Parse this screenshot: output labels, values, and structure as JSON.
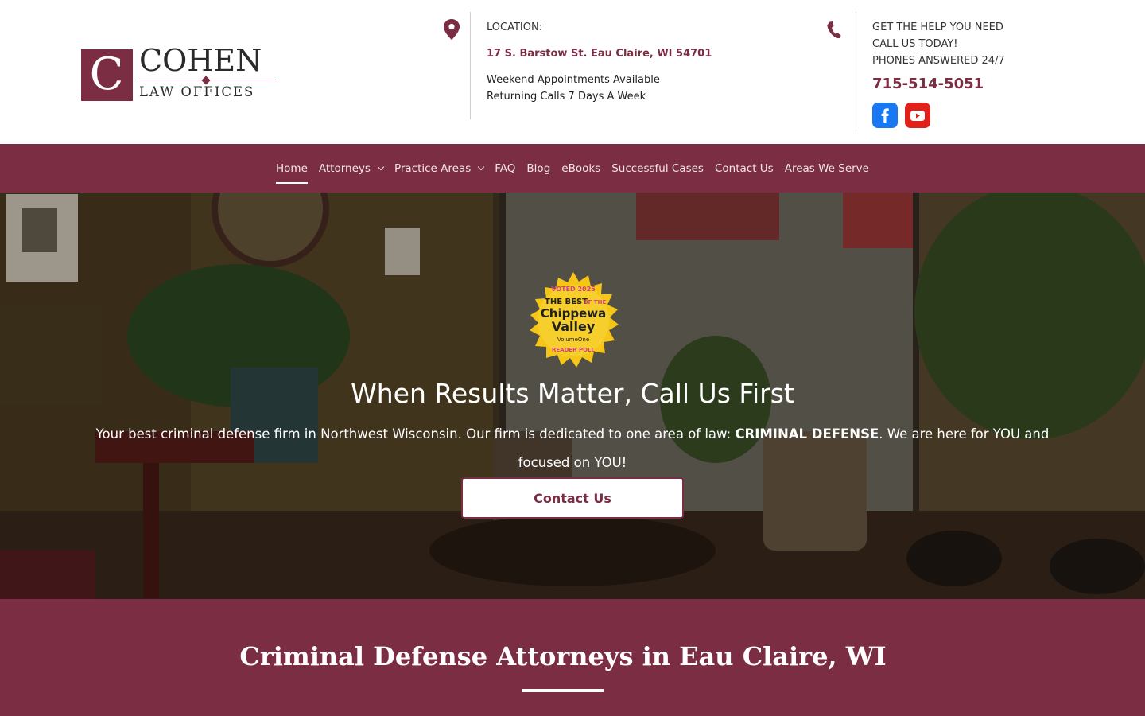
{
  "brand": {
    "logo_letter": "C",
    "logo_name": "COHEN",
    "logo_subtitle": "LAW OFFICES",
    "primary_color": "#7b2d43"
  },
  "contact": {
    "location_label": "LOCATION:",
    "address": "17 S. Barstow St. Eau Claire, WI 54701",
    "note_line1": "Weekend Appointments Available",
    "note_line2": "Returning Calls 7 Days A Week",
    "help_line1": "GET THE HELP YOU NEED",
    "help_line2": "CALL US TODAY!",
    "help_line3": "PHONES ANSWERED 24/7",
    "phone": "715-514-5051",
    "icons": [
      "map-pin-icon",
      "phone-icon",
      "facebook-icon",
      "youtube-icon"
    ]
  },
  "nav": {
    "items": [
      {
        "label": "Home",
        "active": true
      },
      {
        "label": "Attorneys",
        "dropdown": true
      },
      {
        "label": "Practice Areas",
        "dropdown": true
      },
      {
        "label": "FAQ"
      },
      {
        "label": "Blog"
      },
      {
        "label": "eBooks"
      },
      {
        "label": "Successful Cases"
      },
      {
        "label": "Contact Us"
      },
      {
        "label": "Areas We Serve"
      }
    ]
  },
  "hero": {
    "badge": {
      "top": "VOTED 2025",
      "line1": "THE BEST",
      "line2": "OF THE",
      "line3": "Chippewa",
      "line4": "Valley",
      "line5": "VolumeOne",
      "bottom": "READER POLL"
    },
    "title": "When Results Matter, Call Us First",
    "subtitle_pre": "Your best criminal defense firm in Northwest Wisconsin. Our firm is dedicated to one area of law: ",
    "subtitle_bold": "CRIMINAL DEFENSE",
    "subtitle_post": ". We are here for YOU and focused on YOU!",
    "cta_label": "Contact Us"
  },
  "section": {
    "title": "Criminal Defense Attorneys in Eau Claire, WI"
  }
}
